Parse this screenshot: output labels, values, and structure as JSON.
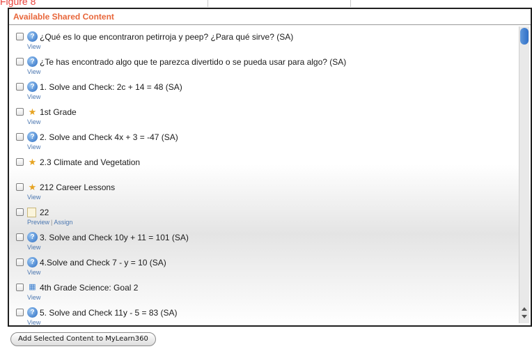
{
  "figure_label": "Figure 8",
  "panel": {
    "header": "Available Shared Content"
  },
  "items": [
    {
      "icon": "question-globe-icon",
      "title": "¿Qué es lo que encontraron petirroja y peep? ¿Para qué sirve? (SA)",
      "links": [
        "View"
      ]
    },
    {
      "icon": "question-globe-icon",
      "title": "¿Te has encontrado algo que te parezca divertido o se pueda usar para algo? (SA)",
      "links": [
        "View"
      ]
    },
    {
      "icon": "question-globe-icon",
      "title": "1. Solve and Check: 2c + 14 = 48 (SA)",
      "links": [
        "View"
      ]
    },
    {
      "icon": "folder-star-icon",
      "title": "1st Grade",
      "links": [
        "View"
      ]
    },
    {
      "icon": "question-globe-icon",
      "title": "2. Solve and Check 4x + 3 = -47 (SA)",
      "links": [
        "View"
      ]
    },
    {
      "icon": "folder-star-icon",
      "title": "2.3 Climate and Vegetation",
      "links": []
    },
    {
      "icon": "folder-star-icon",
      "title": "212 Career Lessons",
      "links": [
        "View"
      ]
    },
    {
      "icon": "document-icon",
      "title": "22",
      "links": [
        "Preview",
        "Assign"
      ]
    },
    {
      "icon": "question-globe-icon",
      "title": "3. Solve and Check 10y + 11 = 101 (SA)",
      "links": [
        "View"
      ]
    },
    {
      "icon": "question-globe-icon",
      "title": "4.Solve and Check 7 - y = 10 (SA)",
      "links": [
        "View"
      ]
    },
    {
      "icon": "grid-icon",
      "title": "4th Grade Science: Goal 2",
      "links": [
        "View"
      ]
    },
    {
      "icon": "question-globe-icon",
      "title": "5. Solve and Check 11y - 5 = 83 (SA)",
      "links": [
        "View"
      ]
    }
  ],
  "add_button": "Add Selected Content to MyLearn360"
}
